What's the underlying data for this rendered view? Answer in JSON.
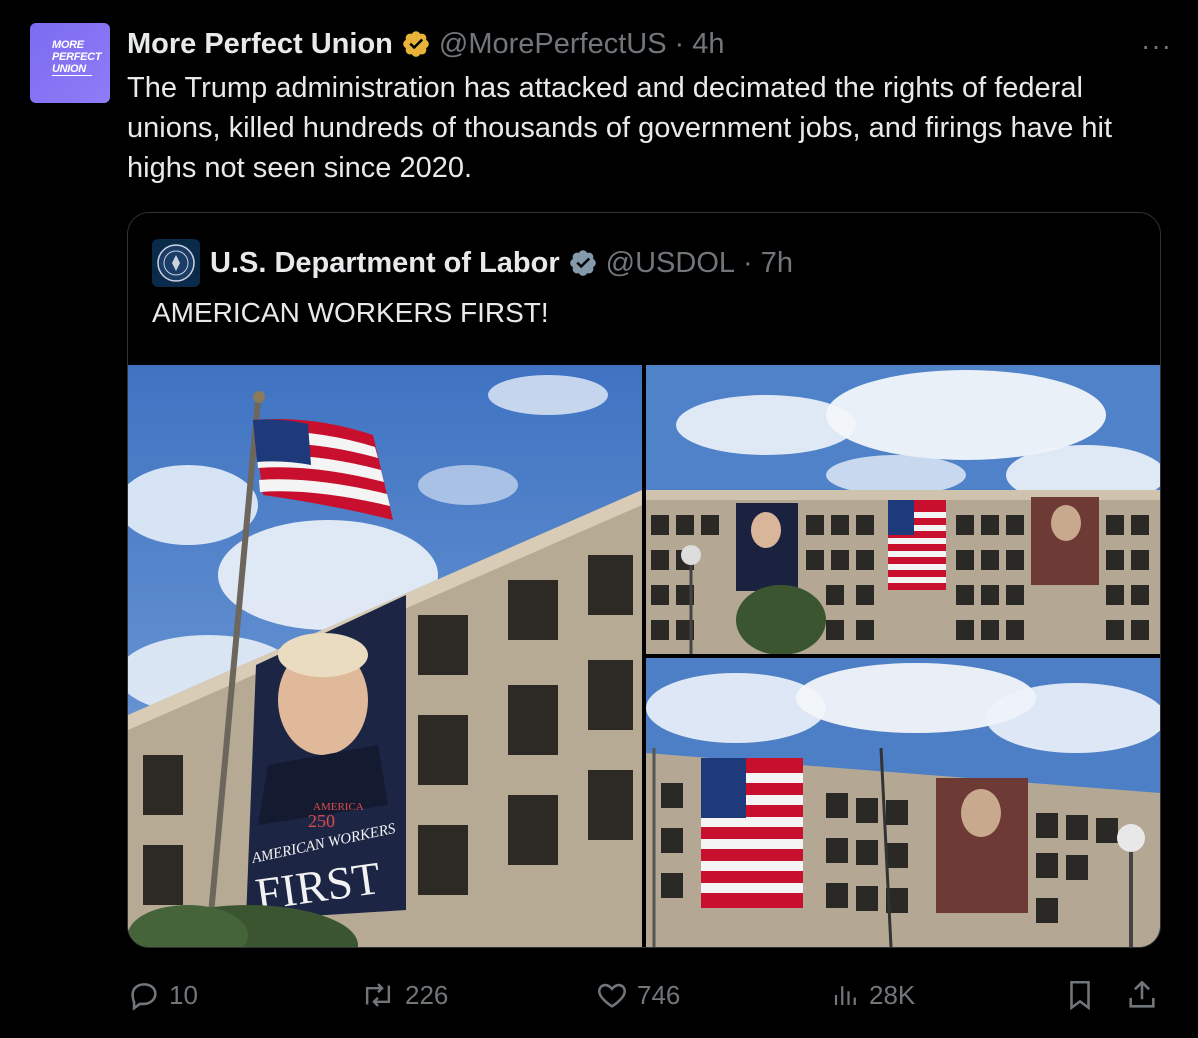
{
  "tweet": {
    "author_name": "More Perfect Union",
    "handle": "@MorePerfectUS",
    "separator": "·",
    "time": "4h",
    "avatar_lines": [
      "MORE",
      "PERFECT",
      "UNION"
    ],
    "text": "The Trump administration has attacked and decimated the rights of federal unions, killed hundreds of thousands of government jobs, and firings have hit highs not seen since 2020.",
    "more_label": "···"
  },
  "quote": {
    "author_name": "U.S. Department of Labor",
    "handle": "@USDOL",
    "separator": "·",
    "time": "7h",
    "text": "AMERICAN WORKERS FIRST!",
    "banner_text": {
      "america": "AMERICA",
      "num": "250",
      "workers": "AMERICAN WORKERS",
      "first": "FIRST"
    }
  },
  "actions": {
    "replies": "10",
    "reposts": "226",
    "likes": "746",
    "views": "28K"
  },
  "icons": {
    "verified": "verified-badge-icon",
    "reply": "reply-icon",
    "repost": "repost-icon",
    "like": "heart-icon",
    "views": "views-icon",
    "bookmark": "bookmark-icon",
    "share": "share-icon",
    "more": "more-icon"
  },
  "colors": {
    "background": "#000000",
    "text": "#e7e9ea",
    "muted": "#71767b",
    "border": "#2f3336",
    "verified_gold": "#e8b339",
    "verified_blue": "#829aab",
    "avatar_purple": "#8677f3"
  }
}
